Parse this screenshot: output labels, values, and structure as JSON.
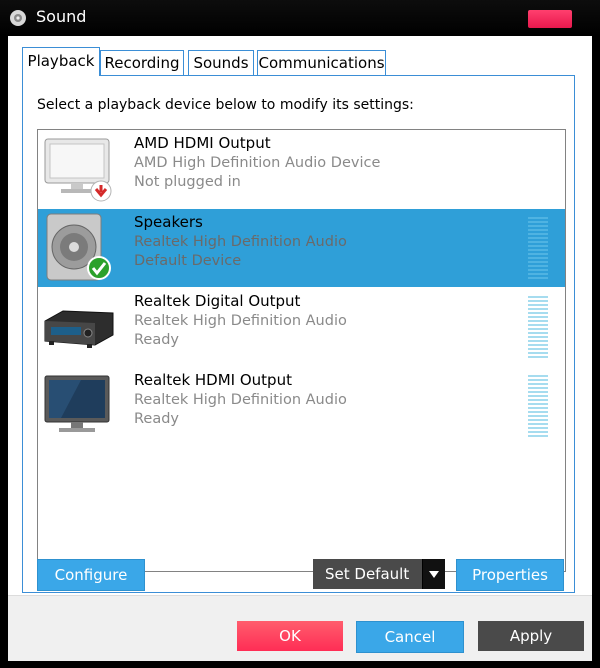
{
  "window": {
    "title": "Sound"
  },
  "tabs": [
    {
      "label": "Playback"
    },
    {
      "label": "Recording"
    },
    {
      "label": "Sounds"
    },
    {
      "label": "Communications"
    }
  ],
  "playback": {
    "instruction": "Select a playback device below to modify its settings:",
    "devices": [
      {
        "name": "AMD HDMI Output",
        "line1": "AMD High Definition Audio Device",
        "line2": "Not plugged in",
        "icon": "monitor-unplugged-icon",
        "selected": false
      },
      {
        "name": "Speakers",
        "line1": "Realtek High Definition Audio",
        "line2": "Default Device",
        "icon": "speaker-default-icon",
        "selected": true
      },
      {
        "name": "Realtek Digital Output",
        "line1": "Realtek High Definition Audio",
        "line2": "Ready",
        "icon": "digital-receiver-icon",
        "selected": false
      },
      {
        "name": "Realtek HDMI Output",
        "line1": "Realtek High Definition Audio",
        "line2": "Ready",
        "icon": "hdmi-monitor-icon",
        "selected": false
      }
    ],
    "buttons": {
      "configure": "Configure",
      "set_default": "Set Default",
      "properties": "Properties"
    }
  },
  "dialog_buttons": {
    "ok": "OK",
    "cancel": "Cancel",
    "apply": "Apply"
  },
  "colors": {
    "accent": "#2f9fd8",
    "button_blue": "#3aa7e8",
    "ok_pink": "#ff2d55",
    "apply_gray": "#4a4a4a"
  }
}
